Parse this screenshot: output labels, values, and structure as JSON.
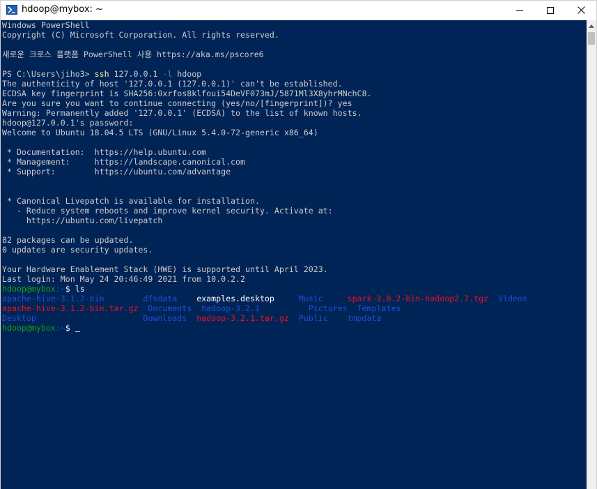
{
  "window": {
    "title": "hdoop@mybox: ~"
  },
  "terminal": {
    "lines": [
      [
        {
          "t": "Windows PowerShell",
          "c": ""
        }
      ],
      [
        {
          "t": "Copyright (C) Microsoft Corporation. All rights reserved.",
          "c": ""
        }
      ],
      [
        {
          "t": "",
          "c": ""
        }
      ],
      [
        {
          "t": "새로운 크로스 플랫폼 PowerShell 사용 https://aka.ms/pscore6",
          "c": ""
        }
      ],
      [
        {
          "t": "",
          "c": ""
        }
      ],
      [
        {
          "t": "PS C:\\Users\\jiho3> ",
          "c": ""
        },
        {
          "t": "ssh",
          "c": "yellow"
        },
        {
          "t": " 127.0.0.1 ",
          "c": ""
        },
        {
          "t": "-l",
          "c": "gray"
        },
        {
          "t": " hdoop",
          "c": ""
        }
      ],
      [
        {
          "t": "The authenticity of host '127.0.0.1 (127.0.0.1)' can't be established.",
          "c": ""
        }
      ],
      [
        {
          "t": "ECDSA key fingerprint is SHA256:0xrfos8klfoui54DeVF073mJ/5871Ml3X8yhrMNchC8.",
          "c": ""
        }
      ],
      [
        {
          "t": "Are you sure you want to continue connecting (yes/no/[fingerprint])? yes",
          "c": ""
        }
      ],
      [
        {
          "t": "Warning: Permanently added '127.0.0.1' (ECDSA) to the list of known hosts.",
          "c": ""
        }
      ],
      [
        {
          "t": "hdoop@127.0.0.1's password:",
          "c": ""
        }
      ],
      [
        {
          "t": "Welcome to Ubuntu 18.04.5 LTS (GNU/Linux 5.4.0-72-generic x86_64)",
          "c": ""
        }
      ],
      [
        {
          "t": "",
          "c": ""
        }
      ],
      [
        {
          "t": " * Documentation:  https://help.ubuntu.com",
          "c": ""
        }
      ],
      [
        {
          "t": " * Management:     https://landscape.canonical.com",
          "c": ""
        }
      ],
      [
        {
          "t": " * Support:        https://ubuntu.com/advantage",
          "c": ""
        }
      ],
      [
        {
          "t": "",
          "c": ""
        }
      ],
      [
        {
          "t": "",
          "c": ""
        }
      ],
      [
        {
          "t": " * Canonical Livepatch is available for installation.",
          "c": ""
        }
      ],
      [
        {
          "t": "   - Reduce system reboots and improve kernel security. Activate at:",
          "c": ""
        }
      ],
      [
        {
          "t": "     https://ubuntu.com/livepatch",
          "c": ""
        }
      ],
      [
        {
          "t": "",
          "c": ""
        }
      ],
      [
        {
          "t": "82 packages can be updated.",
          "c": ""
        }
      ],
      [
        {
          "t": "0 updates are security updates.",
          "c": ""
        }
      ],
      [
        {
          "t": "",
          "c": ""
        }
      ],
      [
        {
          "t": "Your Hardware Enablement Stack (HWE) is supported until April 2023.",
          "c": ""
        }
      ],
      [
        {
          "t": "Last login: Mon May 24 20:46:49 2021 from 10.0.2.2",
          "c": ""
        }
      ],
      [
        {
          "t": "hdoop@mybox",
          "c": "green"
        },
        {
          "t": ":~",
          "c": "blue"
        },
        {
          "t": "$ ls",
          "c": "white"
        }
      ],
      [
        {
          "t": "apache-hive-3.1.2-bin        dfsdata    ",
          "c": "blue"
        },
        {
          "t": "examples.desktop",
          "c": "white"
        },
        {
          "t": "     ",
          "c": ""
        },
        {
          "t": "Music",
          "c": "blue"
        },
        {
          "t": "     ",
          "c": ""
        },
        {
          "t": "spark-3.0.2-bin-hadoop2.7.tgz",
          "c": "red"
        },
        {
          "t": "  ",
          "c": ""
        },
        {
          "t": "Videos",
          "c": "blue"
        }
      ],
      [
        {
          "t": "apache-hive-3.1.2-bin.tar.gz",
          "c": "red"
        },
        {
          "t": "  ",
          "c": ""
        },
        {
          "t": "Documents  hadoop-3.2.1",
          "c": "blue"
        },
        {
          "t": "          ",
          "c": ""
        },
        {
          "t": "Pictures  Templates",
          "c": "blue"
        }
      ],
      [
        {
          "t": "Desktop                      Downloads  ",
          "c": "blue"
        },
        {
          "t": "hadoop-3.2.1.tar.gz",
          "c": "red"
        },
        {
          "t": "  ",
          "c": ""
        },
        {
          "t": "Public    tmpdata",
          "c": "blue"
        }
      ],
      [
        {
          "t": "hdoop@mybox",
          "c": "green"
        },
        {
          "t": ":~",
          "c": "blue"
        },
        {
          "t": "$ ",
          "c": "white"
        },
        {
          "t": "",
          "c": "cursor"
        }
      ]
    ]
  },
  "icons": {
    "app": "powershell-icon",
    "minimize": "minimize-icon",
    "maximize": "maximize-icon",
    "close": "close-icon",
    "scroll_up": "scroll-up-arrow-icon"
  }
}
